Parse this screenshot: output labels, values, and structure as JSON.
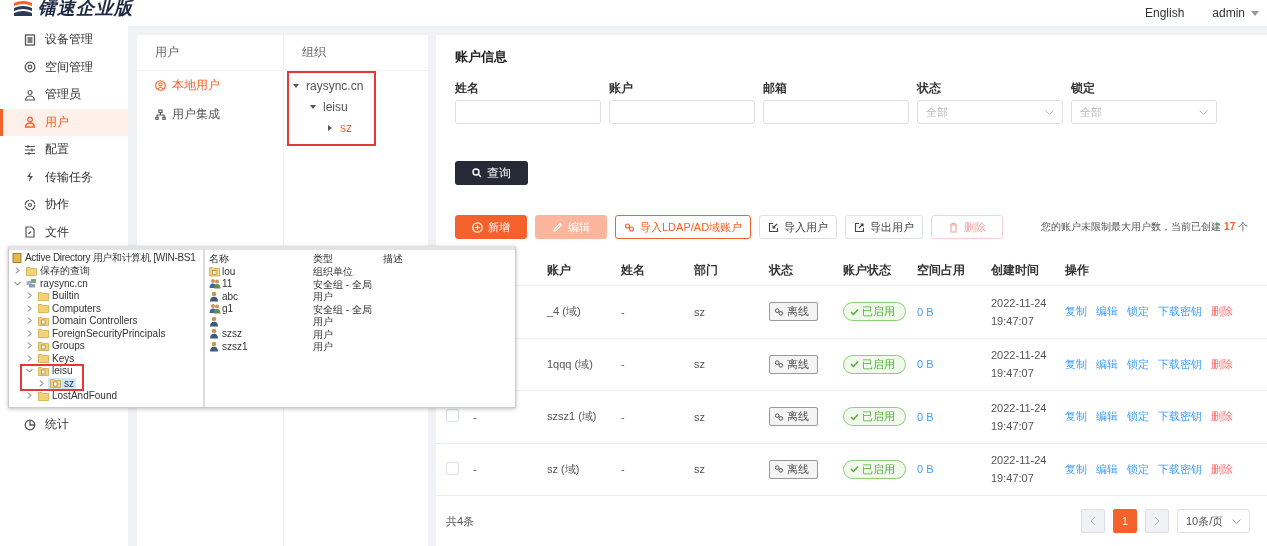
{
  "header": {
    "logo": "镭速企业版",
    "language": "English",
    "user": "admin"
  },
  "sidebar": {
    "items": [
      {
        "label": "设备管理",
        "selected": false
      },
      {
        "label": "空间管理",
        "selected": false
      },
      {
        "label": "管理员",
        "selected": false
      },
      {
        "label": "用户",
        "selected": true
      },
      {
        "label": "配置",
        "selected": false
      },
      {
        "label": "传输任务",
        "selected": false
      },
      {
        "label": "协作",
        "selected": false
      },
      {
        "label": "文件",
        "selected": false
      }
    ],
    "bottom_items": [
      {
        "label": "统计",
        "selected": false
      }
    ]
  },
  "user_panel": {
    "title": "用户",
    "items": [
      {
        "label": "本地用户",
        "selected": true
      },
      {
        "label": "用户集成",
        "selected": false
      }
    ]
  },
  "org_panel": {
    "title": "组织",
    "highlighted": true,
    "tree": [
      {
        "label": "raysync.cn",
        "expanded": true,
        "selected": false,
        "children": [
          {
            "label": "leisu",
            "expanded": true,
            "selected": false,
            "children": [
              {
                "label": "sz",
                "expanded": false,
                "selected": true
              }
            ]
          }
        ]
      }
    ]
  },
  "account_info": {
    "title": "账户信息",
    "filters": [
      {
        "label": "姓名",
        "kind": "input"
      },
      {
        "label": "账户",
        "kind": "input"
      },
      {
        "label": "邮箱",
        "kind": "input"
      },
      {
        "label": "状态",
        "kind": "select",
        "placeholder": "全部"
      },
      {
        "label": "锁定",
        "kind": "select",
        "placeholder": "全部"
      }
    ],
    "search_button": "查询"
  },
  "toolbar": {
    "buttons": [
      {
        "label": "新增",
        "kind": "primary",
        "disabled": false
      },
      {
        "label": "编辑",
        "kind": "primary",
        "disabled": true
      },
      {
        "label": "导入LDAP/AD域账户",
        "kind": "outline",
        "disabled": false
      },
      {
        "label": "导入用户",
        "kind": "default",
        "disabled": false
      },
      {
        "label": "导出用户",
        "kind": "default",
        "disabled": false
      },
      {
        "label": "删除",
        "kind": "danger",
        "disabled": true
      }
    ],
    "note": "您的账户未限制最大用户数，当前已创建 **17** 个"
  },
  "table": {
    "columns": [
      "账户",
      "姓名",
      "部门",
      "状态",
      "账户状态",
      "空间占用",
      "创建时间",
      "操作"
    ],
    "rows": [
      {
        "account": "_4 (域)",
        "name": "-",
        "department": "sz",
        "status": "离线",
        "account_status": "已启用",
        "space": "0 B",
        "created": "2022-11-24\n19:47:07",
        "actions": [
          {
            "label": "复制",
            "kind": "link"
          },
          {
            "label": "编辑",
            "kind": "link"
          },
          {
            "label": "锁定",
            "kind": "link"
          },
          {
            "label": "下载密钥",
            "kind": "link"
          },
          {
            "label": "删除",
            "kind": "danger"
          }
        ]
      },
      {
        "account": "1qqq (域)",
        "name": "-",
        "department": "sz",
        "status": "离线",
        "account_status": "已启用",
        "space": "0 B",
        "created": "2022-11-24\n19:47:07",
        "actions": [
          {
            "label": "复制",
            "kind": "link"
          },
          {
            "label": "编辑",
            "kind": "link"
          },
          {
            "label": "锁定",
            "kind": "link"
          },
          {
            "label": "下载密钥",
            "kind": "link"
          },
          {
            "label": "删除",
            "kind": "danger"
          }
        ]
      },
      {
        "checked": false,
        "column_2": "-",
        "account": "szsz1 (域)",
        "name": "-",
        "department": "sz",
        "status": "离线",
        "account_status": "已启用",
        "space": "0 B",
        "created": "2022-11-24\n19:47:07",
        "actions": [
          {
            "label": "复制",
            "kind": "link"
          },
          {
            "label": "编辑",
            "kind": "link"
          },
          {
            "label": "锁定",
            "kind": "link"
          },
          {
            "label": "下载密钥",
            "kind": "link"
          },
          {
            "label": "删除",
            "kind": "danger"
          }
        ]
      },
      {
        "checked": false,
        "column_2": "-",
        "account": "sz (域)",
        "name": "-",
        "department": "sz",
        "status": "离线",
        "account_status": "已启用",
        "space": "0 B",
        "created": "2022-11-24\n19:47:07",
        "actions": [
          {
            "label": "复制",
            "kind": "link"
          },
          {
            "label": "编辑",
            "kind": "link"
          },
          {
            "label": "锁定",
            "kind": "link"
          },
          {
            "label": "下载密钥",
            "kind": "link"
          },
          {
            "label": "删除",
            "kind": "danger"
          }
        ]
      }
    ],
    "total": "共4条"
  },
  "pagination": {
    "prev_disabled": true,
    "next_disabled": true,
    "pages": [
      {
        "label": "1",
        "selected": true
      }
    ],
    "page_size": "10条/页"
  },
  "ad_window": {
    "title": "Active Directory 用户和计算机 [WIN-BS1",
    "tree": [
      {
        "label": "保存的查询",
        "kind": "folder",
        "expanded": false,
        "selected": false
      },
      {
        "label": "raysync.cn",
        "kind": "domain",
        "expanded": true,
        "selected": false,
        "children": [
          {
            "label": "Builtin",
            "kind": "folder",
            "expanded": false,
            "selected": false
          },
          {
            "label": "Computers",
            "kind": "folder",
            "expanded": false,
            "selected": false
          },
          {
            "label": "Domain Controllers",
            "kind": "ou",
            "expanded": false,
            "selected": false
          },
          {
            "label": "ForeignSecurityPrincipals",
            "kind": "folder",
            "expanded": false,
            "selected": false
          },
          {
            "label": "Groups",
            "kind": "ou",
            "expanded": false,
            "selected": false
          },
          {
            "label": "Keys",
            "kind": "folder",
            "expanded": false,
            "selected": false
          },
          {
            "label": "leisu",
            "kind": "ou",
            "expanded": true,
            "selected": false,
            "highlighted": true,
            "children": [
              {
                "label": "sz",
                "kind": "ou",
                "expanded": false,
                "selected": true
              }
            ]
          },
          {
            "label": "LostAndFound",
            "kind": "folder",
            "expanded": false,
            "selected": false
          }
        ]
      }
    ],
    "columns": [
      "名称",
      "类型",
      "描述"
    ],
    "items": [
      {
        "name": "lou",
        "type": "组织单位",
        "kind": "ou"
      },
      {
        "name": "11",
        "type": "安全组 - 全局",
        "kind": "group"
      },
      {
        "name": "abc",
        "type": "用户",
        "kind": "user"
      },
      {
        "name": "g1",
        "type": "安全组 - 全局",
        "kind": "group"
      },
      {
        "type": "用户",
        "kind": "user"
      },
      {
        "name": "szsz",
        "type": "用户",
        "kind": "user"
      },
      {
        "name": "szsz1",
        "type": "用户",
        "kind": "user"
      }
    ]
  }
}
